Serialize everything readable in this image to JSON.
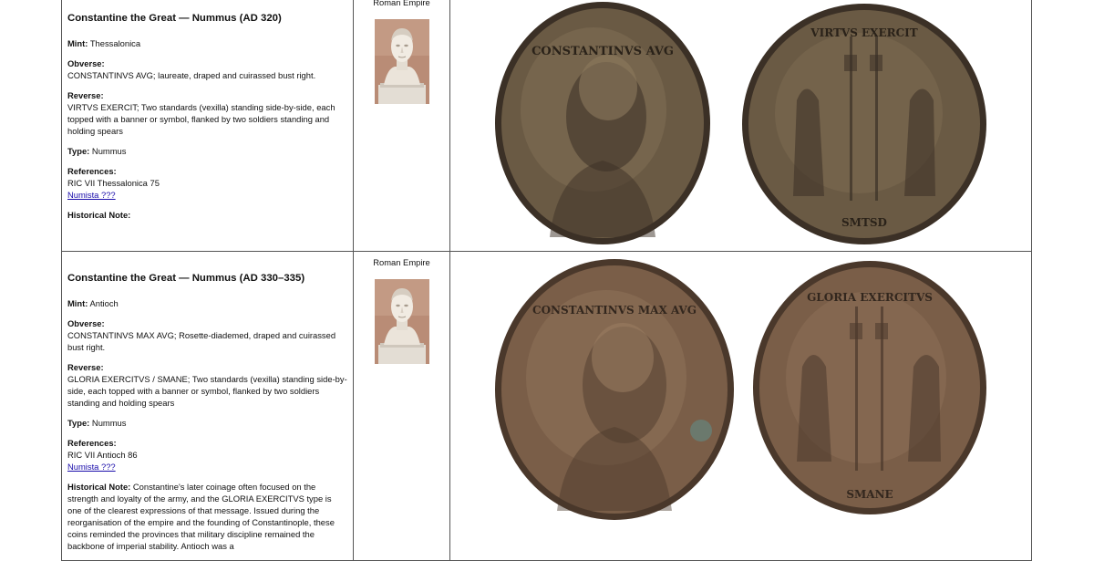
{
  "records": [
    {
      "title": "Constantine the Great — Nummus (AD 320)",
      "mint_label": "Mint:",
      "mint": "Thessalonica",
      "obverse_label": "Obverse:",
      "obverse": "CONSTANTINVS AVG; laureate, draped and cuirassed bust right.",
      "reverse_label": "Reverse:",
      "reverse": "VIRTVS EXERCIT; Two standards (vexilla) standing side-by-side, each topped with a banner or symbol, flanked by two soldiers standing and holding spears",
      "type_label": "Type:",
      "type": "Nummus",
      "references_label": "References:",
      "reference": "RIC VII Thessalonica 75",
      "numista": "Numista ???",
      "note_label": "Historical Note:",
      "note": "",
      "empire": "Roman Empire",
      "portrait_icon": "marble-bust-portrait",
      "obverse_inscription": "CONSTANTINVS AVG",
      "reverse_inscription": "VIRTVS EXERCIT",
      "exergue": "SMTSD",
      "coin_colors": {
        "base": "#6a5a44",
        "light": "#8c7a5e",
        "dark": "#3b3026"
      }
    },
    {
      "title": "Constantine the Great — Nummus (AD 330–335)",
      "mint_label": "Mint:",
      "mint": "Antioch",
      "obverse_label": "Obverse:",
      "obverse": "CONSTANTINVS MAX AVG; Rosette-diademed, draped and cuirassed bust right.",
      "reverse_label": "Reverse:",
      "reverse": "GLORIA EXERCITVS / SMANE; Two standards (vexilla) standing side-by-side, each topped with a banner or symbol, flanked by two soldiers standing and holding spears",
      "type_label": "Type:",
      "type": "Nummus",
      "references_label": "References:",
      "reference": "RIC VII Antioch 86",
      "numista": "Numista ???",
      "note_label": "Historical Note:",
      "note": "Constantine's later coinage often focused on the strength and loyalty of the army, and the GLORIA EXERCITVS type is one of the clearest expressions of that message. Issued during the reorganisation of the empire and the founding of Constantinople, these coins reminded the provinces that military discipline remained the backbone of imperial stability. Antioch was a",
      "empire": "Roman Empire",
      "portrait_icon": "marble-bust-portrait",
      "obverse_inscription": "CONSTANTINVS MAX AVG",
      "reverse_inscription": "GLORIA EXERCITVS",
      "exergue": "SMANE",
      "coin_colors": {
        "base": "#7a5e48",
        "light": "#9b7d63",
        "dark": "#4a382b"
      }
    }
  ]
}
